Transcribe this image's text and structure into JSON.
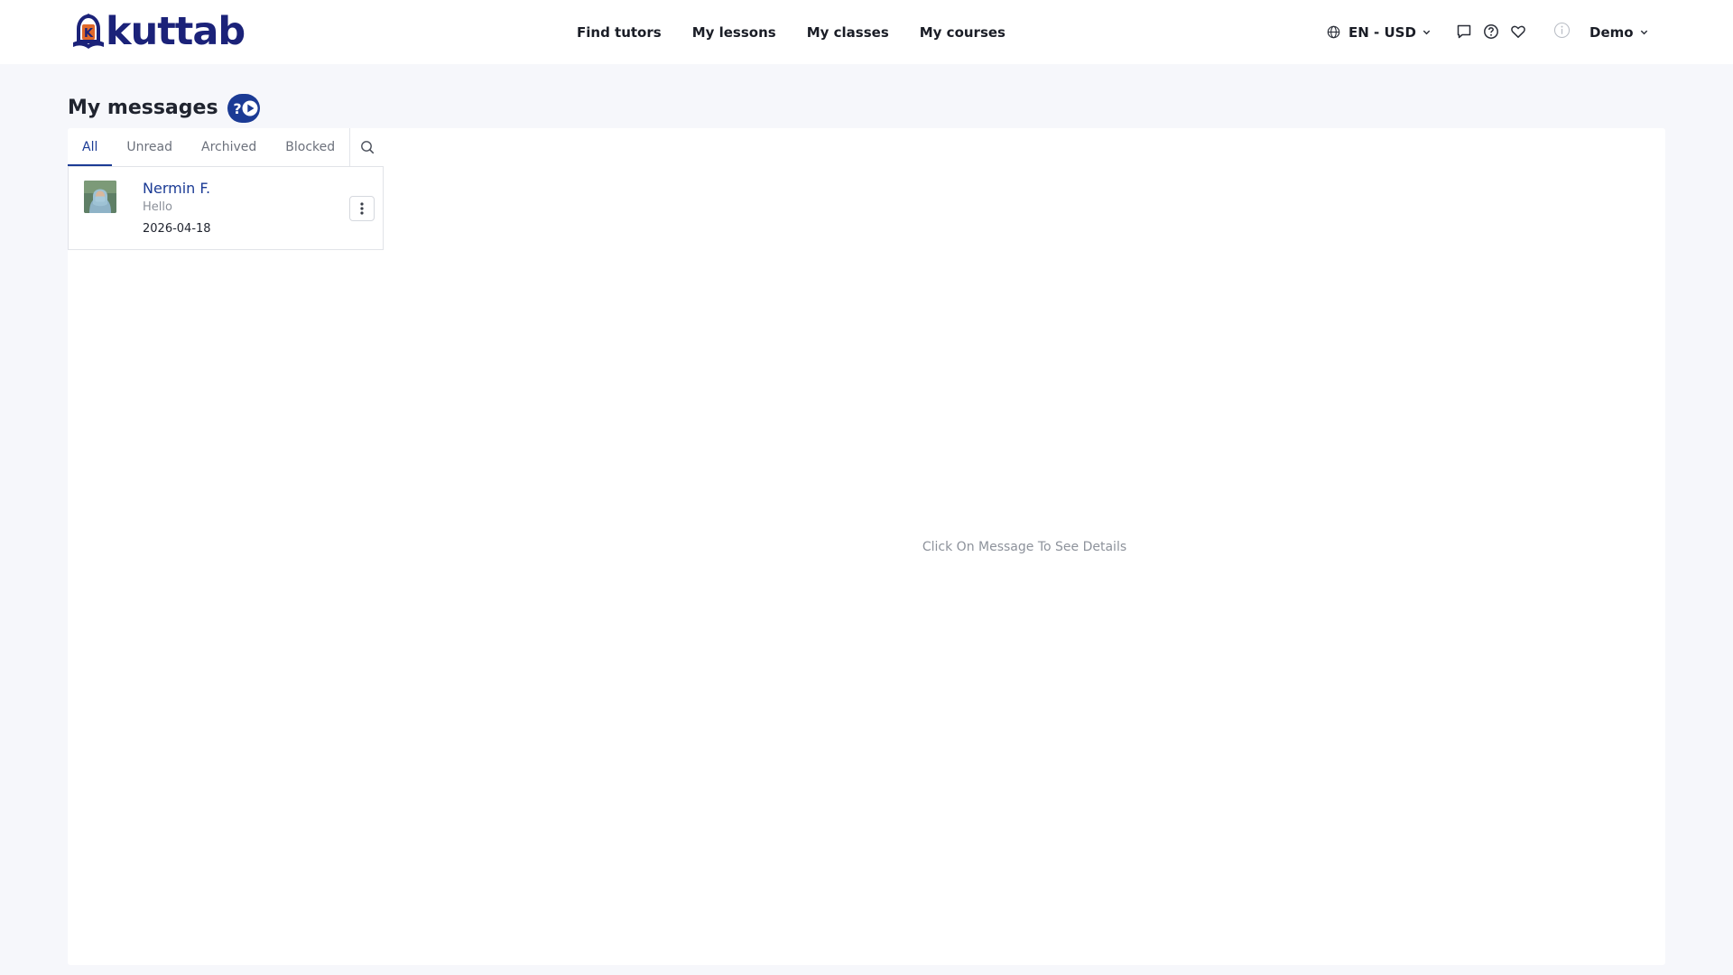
{
  "brand": {
    "name": "kuttab",
    "primary_color": "#1b2279",
    "accent_color": "#e0682a"
  },
  "nav": {
    "items": [
      {
        "label": "Find tutors"
      },
      {
        "label": "My lessons"
      },
      {
        "label": "My classes"
      },
      {
        "label": "My courses"
      }
    ]
  },
  "locale": {
    "label": "EN - USD",
    "icon": "globe-icon"
  },
  "header_icons": [
    "messages-icon",
    "help-circle-icon",
    "heart-icon",
    "info-icon"
  ],
  "user": {
    "name": "Demo"
  },
  "page": {
    "title": "My messages",
    "help_icon": "help-video-icon"
  },
  "tabs": [
    {
      "label": "All",
      "active": true
    },
    {
      "label": "Unread",
      "active": false
    },
    {
      "label": "Archived",
      "active": false
    },
    {
      "label": "Blocked",
      "active": false
    }
  ],
  "threads": [
    {
      "name": "Nermin F.",
      "preview": "Hello",
      "date": "2026-04-18"
    }
  ],
  "detail": {
    "empty_text": "Click On Message To See Details"
  }
}
